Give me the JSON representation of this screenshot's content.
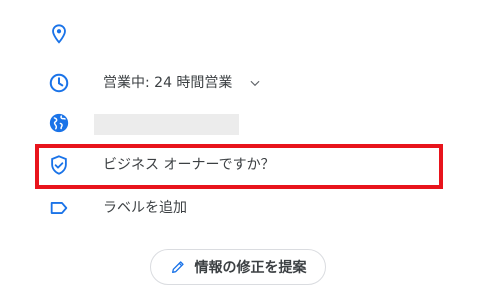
{
  "accent": "#1a73e8",
  "highlight_color": "#e8141c",
  "rows": {
    "location": {
      "icon": "location-pin-icon"
    },
    "hours": {
      "icon": "clock-icon",
      "label": "営業中: 24 時間営業",
      "toggle_icon": "chevron-down-icon"
    },
    "website": {
      "icon": "globe-icon"
    },
    "owner": {
      "icon": "verified-shield-icon",
      "label": "ビジネス オーナーですか？"
    },
    "add_label": {
      "icon": "label-tag-icon",
      "label": "ラベルを追加"
    }
  },
  "suggest_edit": {
    "icon": "pencil-icon",
    "label": "情報の修正を提案"
  }
}
